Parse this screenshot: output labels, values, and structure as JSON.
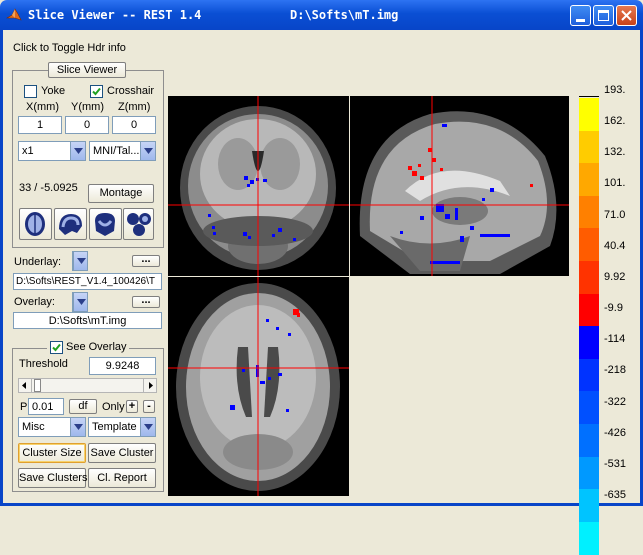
{
  "window": {
    "title": "Slice Viewer -- REST 1.4",
    "file": "D:\\Softs\\mT.img"
  },
  "header_toggle": "Click to Toggle Hdr info",
  "panel": {
    "title": "Slice Viewer",
    "yoke_label": "Yoke",
    "crosshair_label": "Crosshair",
    "coord_labels": [
      "X(mm)",
      "Y(mm)",
      "Z(mm)"
    ],
    "coords": [
      "1",
      "0",
      "0"
    ],
    "zoom": "x1",
    "space": "MNI/Tal...",
    "slice_info": "33 / -5.0925",
    "montage_label": "Montage"
  },
  "underlay": {
    "label": "Underlay:",
    "browse": "...",
    "path": "D:\\Softs\\REST_V1.4_100426\\T"
  },
  "overlay": {
    "label": "Overlay:",
    "browse": "...",
    "path": "D:\\Softs\\mT.img"
  },
  "overlay_panel": {
    "see_overlay": "See Overlay",
    "threshold_label": "Threshold",
    "threshold_value": "9.9248",
    "p_label": "P",
    "p_value": "0.01",
    "df_label": "df",
    "only_label": "Only",
    "plus": "+",
    "minus": "-",
    "misc": "Misc",
    "template": "Template",
    "cluster_size": "Cluster Size",
    "save_cluster": "Save Cluster",
    "save_clusters": "Save Clusters",
    "cl_report": "Cl. Report"
  },
  "colorbar": {
    "ticks": [
      "193.",
      "162.",
      "132.",
      "101.",
      "71.0",
      "40.4",
      "9.92",
      "-9.9",
      "-114",
      "-218",
      "-322",
      "-426",
      "-531",
      "-635"
    ],
    "colors": [
      "#ffff00",
      "#ffcc00",
      "#ffa800",
      "#ff8000",
      "#ff5c00",
      "#ff3300",
      "#ff0000",
      "#0000ff",
      "#0033ff",
      "#0050ff",
      "#0070ff",
      "#0099ff",
      "#00c4ff",
      "#00f0ff"
    ]
  }
}
